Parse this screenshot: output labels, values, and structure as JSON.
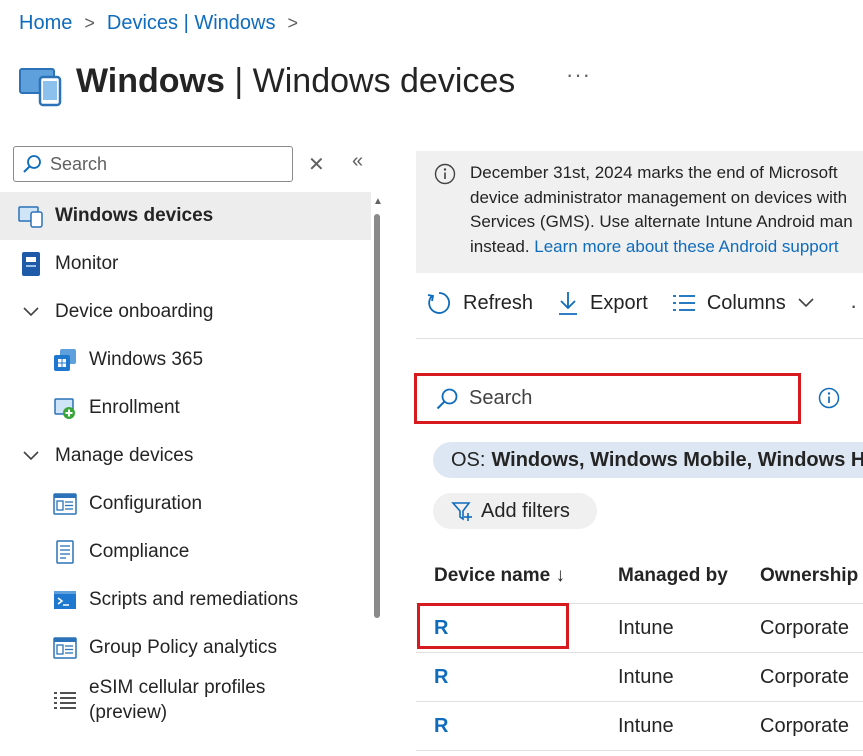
{
  "breadcrumb": {
    "items": [
      "Home",
      "Devices | Windows"
    ]
  },
  "header": {
    "title_bold": "Windows",
    "title_sep": " | ",
    "title_rest": "Windows devices",
    "more": "···"
  },
  "nav": {
    "search_placeholder": "Search",
    "clear_icon": "✕",
    "collapse_icon": "«",
    "items": [
      {
        "label": "Windows devices",
        "active": true
      },
      {
        "label": "Monitor"
      },
      {
        "label": "Device onboarding",
        "group": true
      },
      {
        "label": "Windows 365"
      },
      {
        "label": "Enrollment"
      },
      {
        "label": "Manage devices",
        "group": true
      },
      {
        "label": "Configuration"
      },
      {
        "label": "Compliance"
      },
      {
        "label": "Scripts and remediations"
      },
      {
        "label": "Group Policy analytics"
      },
      {
        "label_line1": "eSIM cellular profiles",
        "label_line2": "(preview)"
      }
    ]
  },
  "banner": {
    "line1": "December 31st, 2024 marks the end of Microsoft",
    "line2": "device administrator management on devices with",
    "line3": "Services (GMS). Use alternate Intune Android man",
    "line4_text": "instead. ",
    "line4_link": "Learn more about these Android support"
  },
  "toolbar": {
    "refresh": "Refresh",
    "export": "Export",
    "columns": "Columns",
    "more": "·"
  },
  "main_search": {
    "placeholder": "Search"
  },
  "filter": {
    "key": "OS:",
    "value": "Windows, Windows Mobile, Windows H"
  },
  "add_filters": "Add filters",
  "table": {
    "columns": [
      "Device name ↓",
      "Managed by",
      "Ownership"
    ],
    "rows": [
      [
        "R",
        "Intune",
        "Corporate"
      ],
      [
        "R",
        "Intune",
        "Corporate"
      ],
      [
        "R",
        "Intune",
        "Corporate"
      ]
    ]
  },
  "colors": {
    "link": "#0f6cbd",
    "highlight": "#d71920",
    "pill": "#dce7f3",
    "active_nav": "#ededed"
  }
}
